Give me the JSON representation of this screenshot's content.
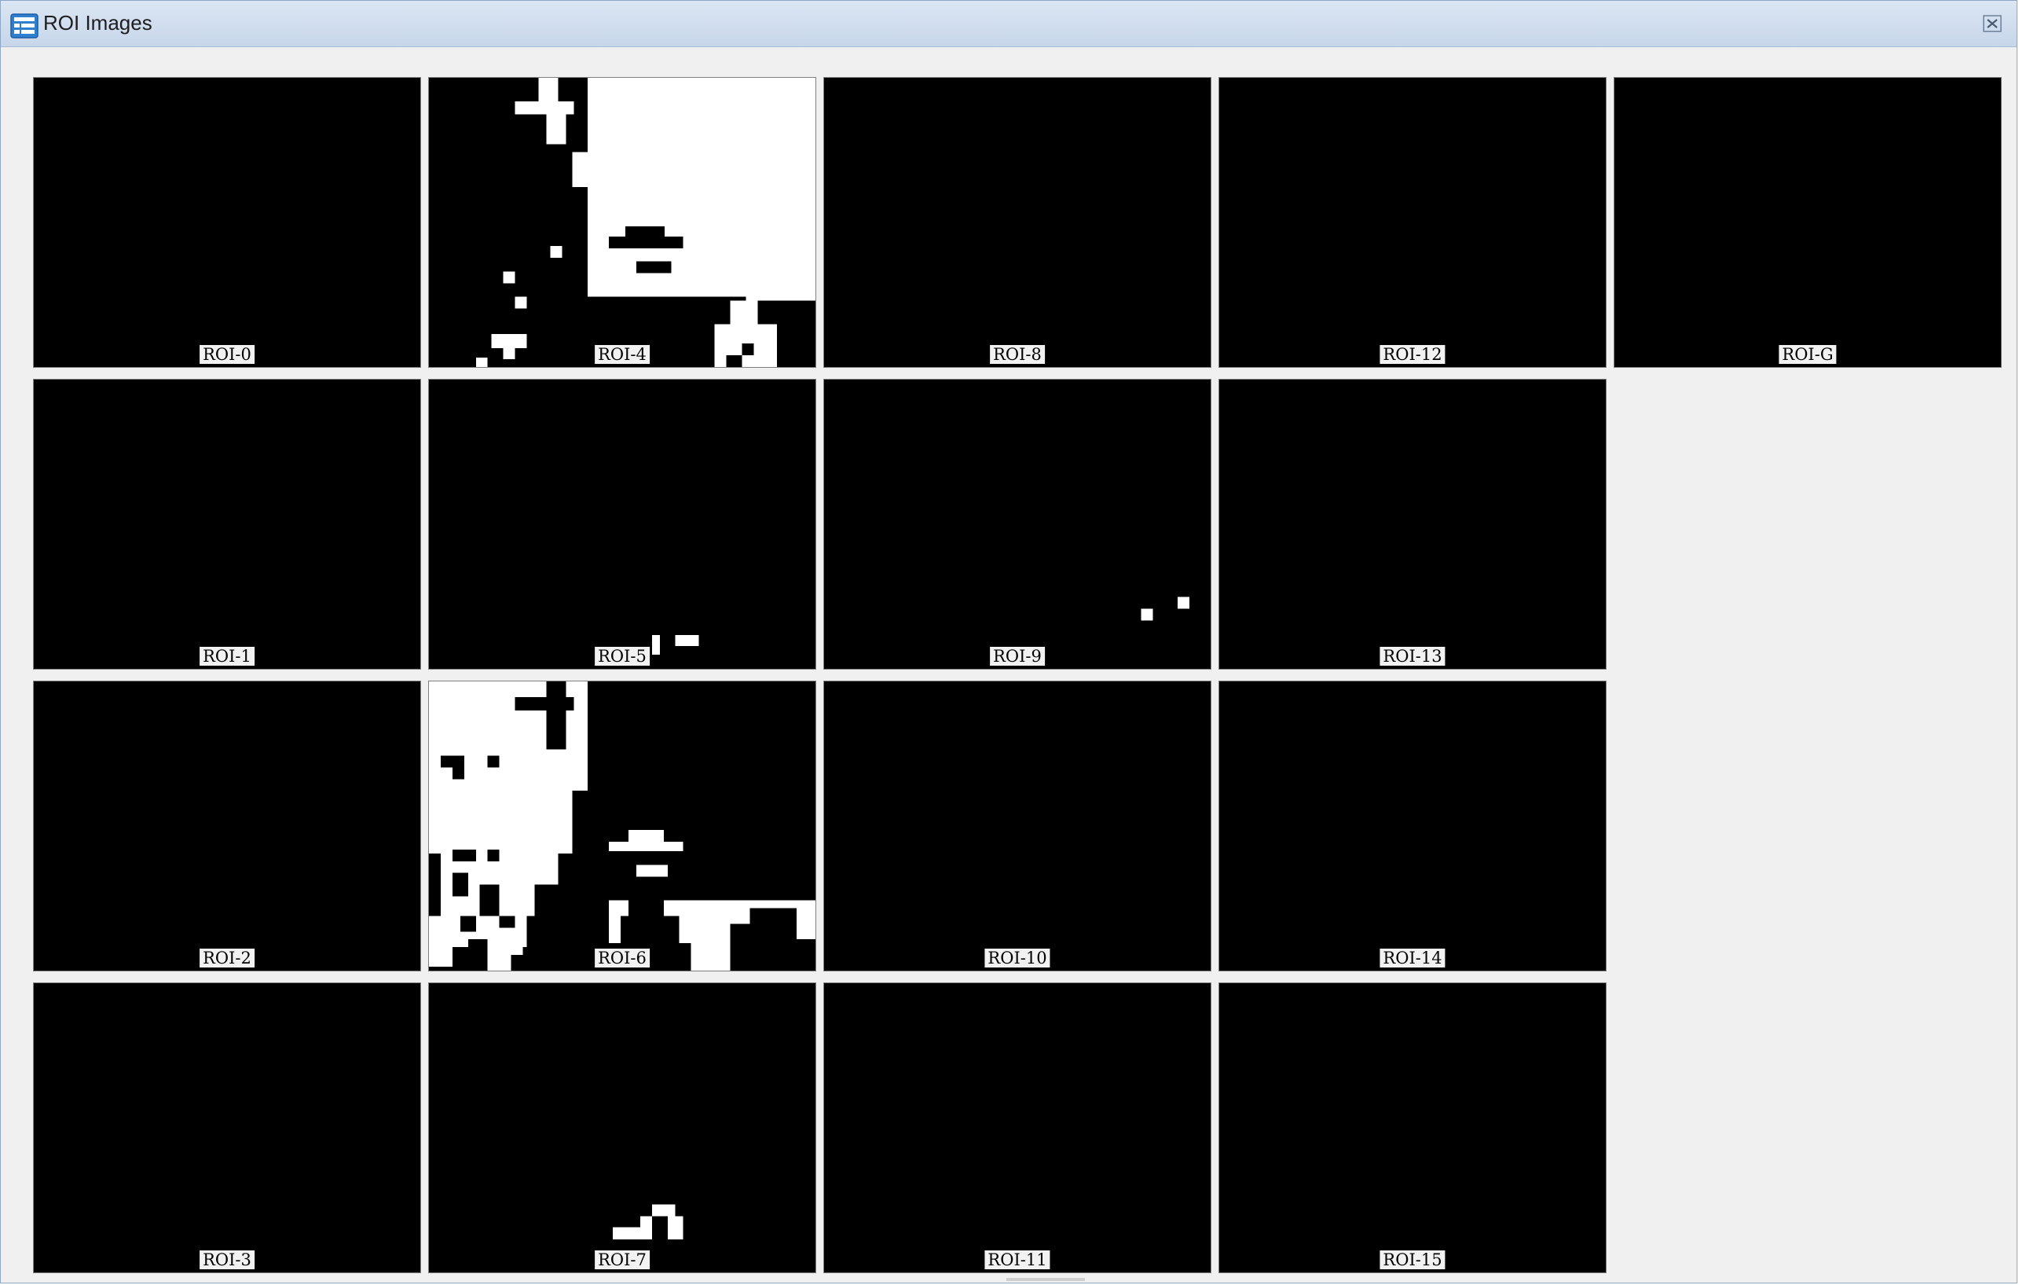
{
  "window": {
    "title": "ROI Images",
    "icon": "grid-window-icon",
    "close_icon": "close-icon"
  },
  "tiles": {
    "roi0": {
      "label": "ROI-0"
    },
    "roi1": {
      "label": "ROI-1"
    },
    "roi2": {
      "label": "ROI-2"
    },
    "roi3": {
      "label": "ROI-3"
    },
    "roi4": {
      "label": "ROI-4"
    },
    "roi5": {
      "label": "ROI-5"
    },
    "roi6": {
      "label": "ROI-6"
    },
    "roi7": {
      "label": "ROI-7"
    },
    "roi8": {
      "label": "ROI-8"
    },
    "roi9": {
      "label": "ROI-9"
    },
    "roi10": {
      "label": "ROI-10"
    },
    "roi11": {
      "label": "ROI-11"
    },
    "roi12": {
      "label": "ROI-12"
    },
    "roi13": {
      "label": "ROI-13"
    },
    "roi14": {
      "label": "ROI-14"
    },
    "roi15": {
      "label": "ROI-15"
    },
    "roiG": {
      "label": "ROI-G"
    }
  },
  "colors": {
    "mask_foreground": "#ffffff",
    "mask_background": "#000000",
    "window_background": "#f0f0f0",
    "title_bar": "#c7d6ea"
  }
}
